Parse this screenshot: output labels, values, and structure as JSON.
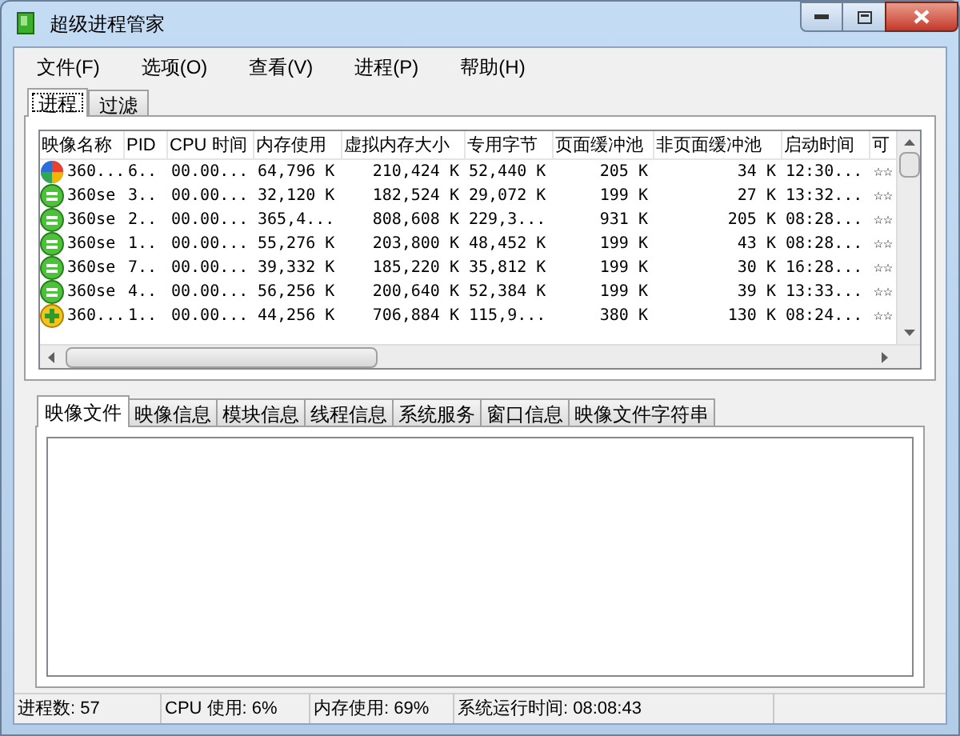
{
  "window": {
    "title": "超级进程管家"
  },
  "menu": [
    "文件(F)",
    "选项(O)",
    "查看(V)",
    "进程(P)",
    "帮助(H)"
  ],
  "tabs": [
    {
      "label": "进程",
      "selected": true
    },
    {
      "label": "过滤",
      "selected": false
    }
  ],
  "table": {
    "columns": [
      "映像名称",
      "PID",
      "CPU 时间",
      "内存使用",
      "虚拟内存大小",
      "专用字节",
      "页面缓冲池",
      "非页面缓冲池",
      "启动时间",
      "可"
    ],
    "rows": [
      {
        "kind": "multicolor",
        "cells": [
          "360...",
          "6..",
          "00.00...",
          "64,796 K",
          "210,424 K",
          "52,440 K",
          "205 K",
          "34 K",
          "12:30...",
          "☆☆"
        ]
      },
      {
        "kind": "green",
        "cells": [
          "360se",
          "3..",
          "00.00...",
          "32,120 K",
          "182,524 K",
          "29,072 K",
          "199 K",
          "27 K",
          "13:32...",
          "☆☆"
        ]
      },
      {
        "kind": "green",
        "cells": [
          "360se",
          "2..",
          "00.00...",
          "365,4...",
          "808,608 K",
          "229,3...",
          "931 K",
          "205 K",
          "08:28...",
          "☆☆"
        ]
      },
      {
        "kind": "green",
        "cells": [
          "360se",
          "1..",
          "00.00...",
          "55,276 K",
          "203,800 K",
          "48,452 K",
          "199 K",
          "43 K",
          "08:28...",
          "☆☆"
        ]
      },
      {
        "kind": "green",
        "cells": [
          "360se",
          "7..",
          "00.00...",
          "39,332 K",
          "185,220 K",
          "35,812 K",
          "199 K",
          "30 K",
          "16:28...",
          "☆☆"
        ]
      },
      {
        "kind": "green",
        "cells": [
          "360se",
          "4..",
          "00.00...",
          "56,256 K",
          "200,640 K",
          "52,384 K",
          "199 K",
          "39 K",
          "13:33...",
          "☆☆"
        ]
      },
      {
        "kind": "yellow",
        "cells": [
          "360...",
          "1..",
          "00.00...",
          "44,256 K",
          "706,884 K",
          "115,9...",
          "380 K",
          "130 K",
          "08:24...",
          "☆☆"
        ]
      }
    ]
  },
  "detail_tabs": [
    {
      "label": "映像文件",
      "selected": true
    },
    {
      "label": "映像信息",
      "selected": false
    },
    {
      "label": "模块信息",
      "selected": false
    },
    {
      "label": "线程信息",
      "selected": false
    },
    {
      "label": "系统服务",
      "selected": false
    },
    {
      "label": "窗口信息",
      "selected": false
    },
    {
      "label": "映像文件字符串",
      "selected": false
    }
  ],
  "status_bar": [
    "进程数: 57",
    "CPU 使用: 6%",
    "内存使用: 69%",
    "系统运行时间: 08:08:43"
  ]
}
